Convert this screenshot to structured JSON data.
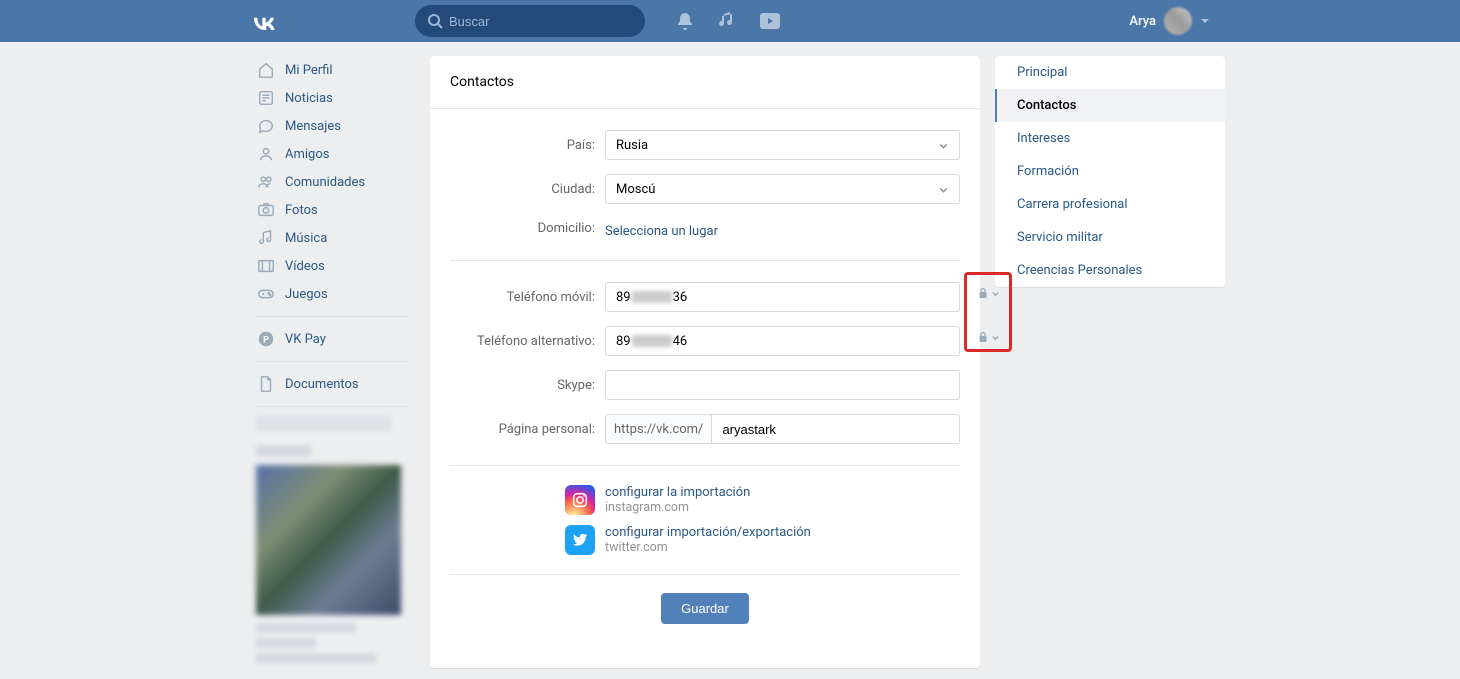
{
  "header": {
    "search_placeholder": "Buscar",
    "user_name": "Arya"
  },
  "sidebar": {
    "items": [
      {
        "label": "Mi Perfil"
      },
      {
        "label": "Noticias"
      },
      {
        "label": "Mensajes"
      },
      {
        "label": "Amigos"
      },
      {
        "label": "Comunidades"
      },
      {
        "label": "Fotos"
      },
      {
        "label": "Música"
      },
      {
        "label": "Vídeos"
      },
      {
        "label": "Juegos"
      }
    ],
    "pay": "VK Pay",
    "documents": "Documentos"
  },
  "panel": {
    "title": "Contactos",
    "labels": {
      "country": "País:",
      "city": "Ciudad:",
      "home": "Domicilio:",
      "mobile": "Teléfono móvil:",
      "alt_phone": "Teléfono alternativo:",
      "skype": "Skype:",
      "personal_page": "Página personal:"
    },
    "values": {
      "country": "Rusia",
      "city": "Moscú",
      "home_link": "Selecciona un lugar",
      "mobile_prefix": "89",
      "mobile_suffix": "36",
      "alt_prefix": "89",
      "alt_suffix": "46",
      "url_prefix": "https://vk.com/",
      "url_value": "aryastark"
    },
    "social": {
      "instagram_link": "configurar la importación",
      "instagram_domain": "instagram.com",
      "twitter_link": "configurar importación/exportación",
      "twitter_domain": "twitter.com"
    },
    "save_label": "Guardar"
  },
  "side_nav": {
    "items": [
      {
        "label": "Principal",
        "active": false
      },
      {
        "label": "Contactos",
        "active": true
      },
      {
        "label": "Intereses",
        "active": false
      },
      {
        "label": "Formación",
        "active": false
      },
      {
        "label": "Carrera profesional",
        "active": false
      },
      {
        "label": "Servicio militar",
        "active": false
      },
      {
        "label": "Creencias Personales",
        "active": false
      }
    ]
  }
}
